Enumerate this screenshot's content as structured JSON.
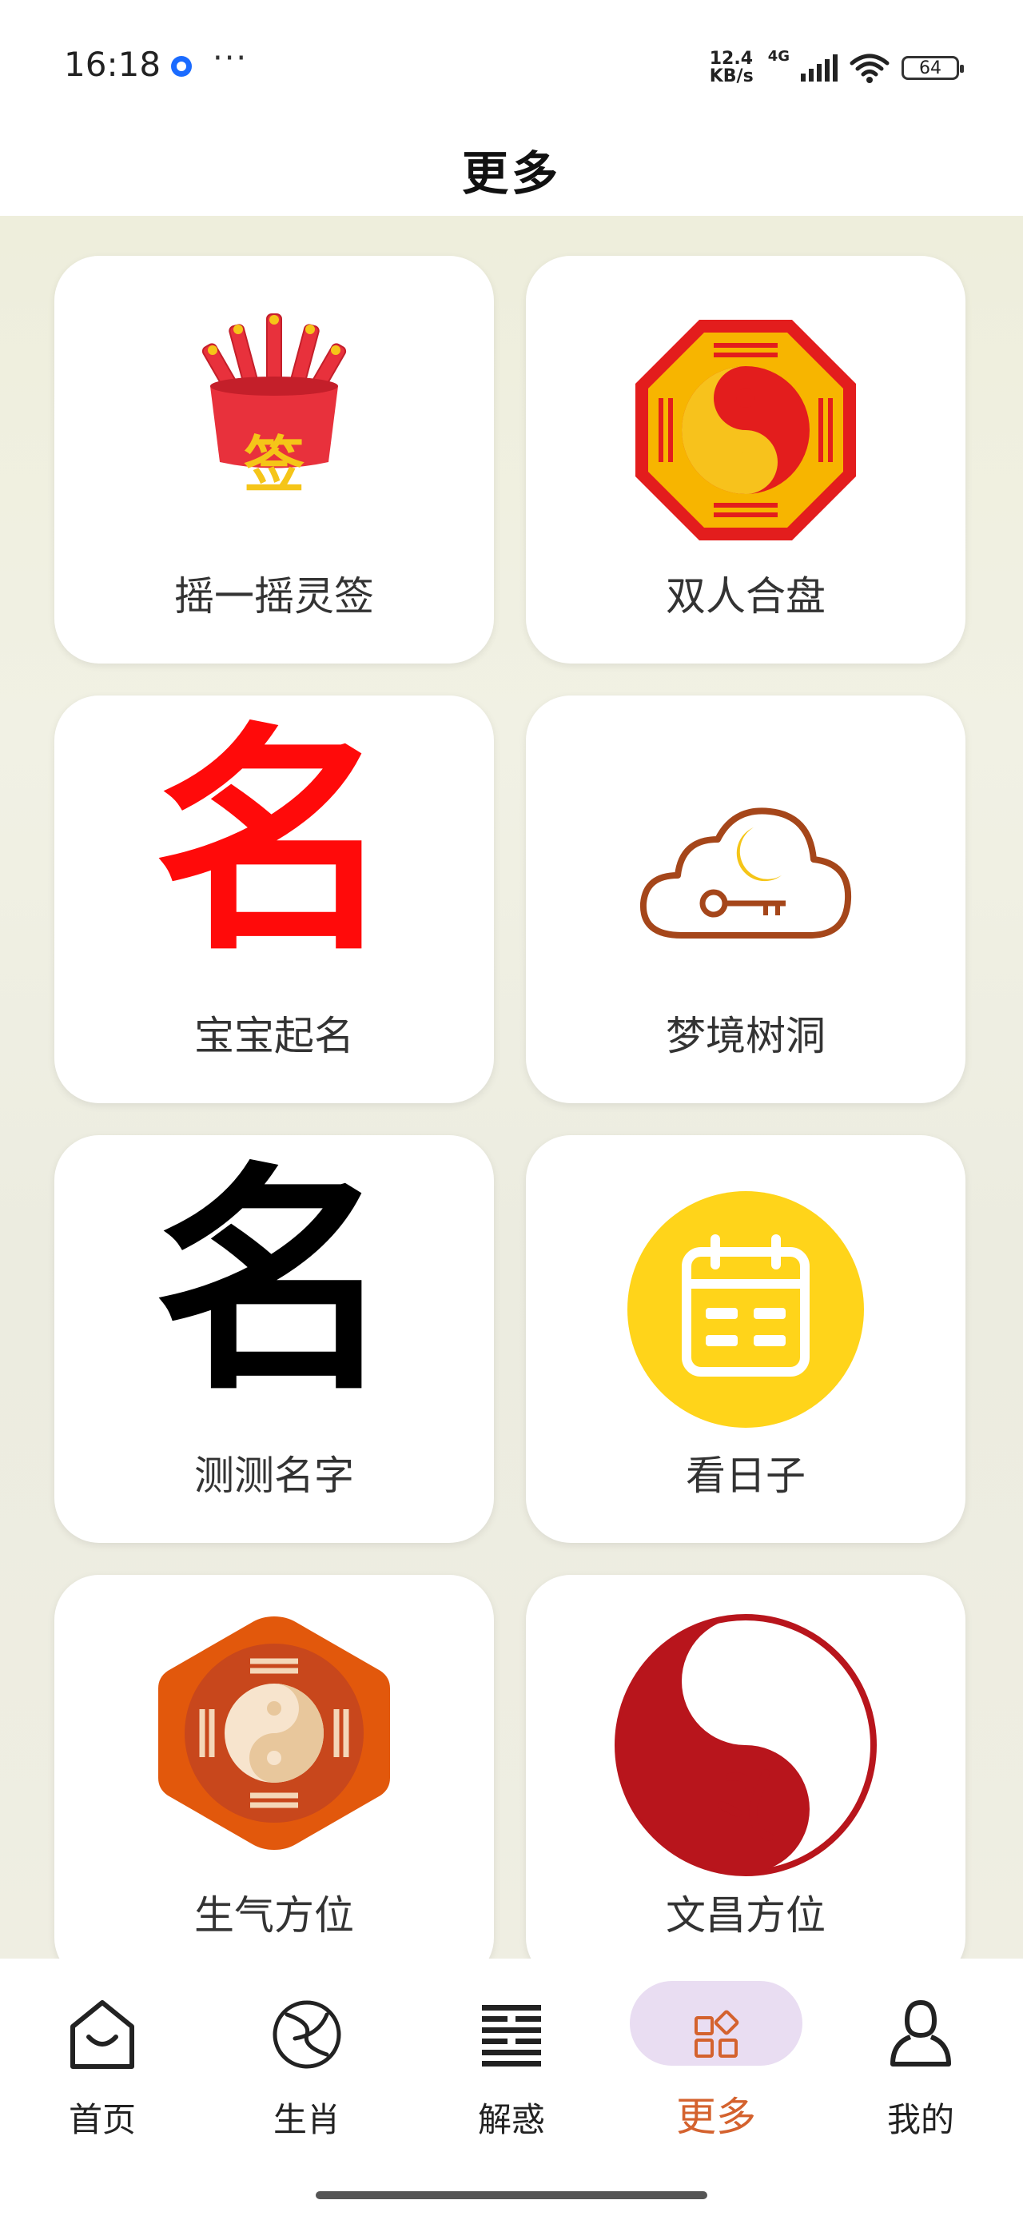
{
  "status_bar": {
    "time": "16:18",
    "more": "···",
    "net_speed_value": "12.4",
    "net_speed_unit": "KB/s",
    "network_type": "4G",
    "battery": "64"
  },
  "header": {
    "title": "更多"
  },
  "grid": {
    "items": [
      {
        "label": "摇一摇灵签",
        "icon": "fortune-stick-cup-icon",
        "icon_text": "签"
      },
      {
        "label": "双人合盘",
        "icon": "bagua-yinyang-icon"
      },
      {
        "label": "宝宝起名",
        "icon": "red-name-character-icon",
        "icon_text": "名"
      },
      {
        "label": "梦境树洞",
        "icon": "cloud-moon-key-icon"
      },
      {
        "label": "测测名字",
        "icon": "black-name-character-icon",
        "icon_text": "名"
      },
      {
        "label": "看日子",
        "icon": "calendar-icon"
      },
      {
        "label": "生气方位",
        "icon": "hexagon-bagua-icon"
      },
      {
        "label": "文昌方位",
        "icon": "red-yinyang-calligraphy-icon"
      }
    ]
  },
  "bottom_nav": {
    "items": [
      {
        "label": "首页",
        "icon": "home-bag-icon"
      },
      {
        "label": "生肖",
        "icon": "zodiac-swirl-icon"
      },
      {
        "label": "解惑",
        "icon": "hexagram-lines-icon"
      },
      {
        "label": "更多",
        "icon": "grid-squares-icon",
        "active": true
      },
      {
        "label": "我的",
        "icon": "person-icon"
      }
    ],
    "active_color": "#d4622e"
  }
}
